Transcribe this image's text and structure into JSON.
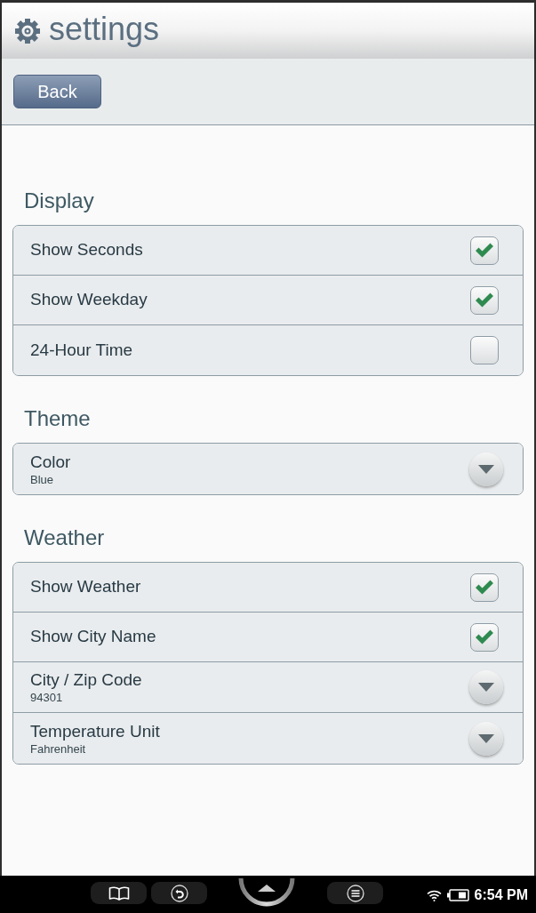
{
  "header": {
    "title": "settings"
  },
  "toolbar": {
    "back_button": "Back"
  },
  "sections": [
    {
      "title": "Display",
      "rows": [
        {
          "kind": "checkbox",
          "label": "Show Seconds",
          "checked": true
        },
        {
          "kind": "checkbox",
          "label": "Show Weekday",
          "checked": true
        },
        {
          "kind": "checkbox",
          "label": "24-Hour Time",
          "checked": false
        }
      ]
    },
    {
      "title": "Theme",
      "rows": [
        {
          "kind": "select",
          "label": "Color",
          "value": "Blue"
        }
      ]
    },
    {
      "title": "Weather",
      "rows": [
        {
          "kind": "checkbox",
          "label": "Show Weather",
          "checked": true
        },
        {
          "kind": "checkbox",
          "label": "Show City Name",
          "checked": true
        },
        {
          "kind": "select",
          "label": "City / Zip Code",
          "value": "94301"
        },
        {
          "kind": "select",
          "label": "Temperature Unit",
          "value": "Fahrenheit"
        }
      ]
    }
  ],
  "status_bar": {
    "time": "6:54 PM"
  }
}
